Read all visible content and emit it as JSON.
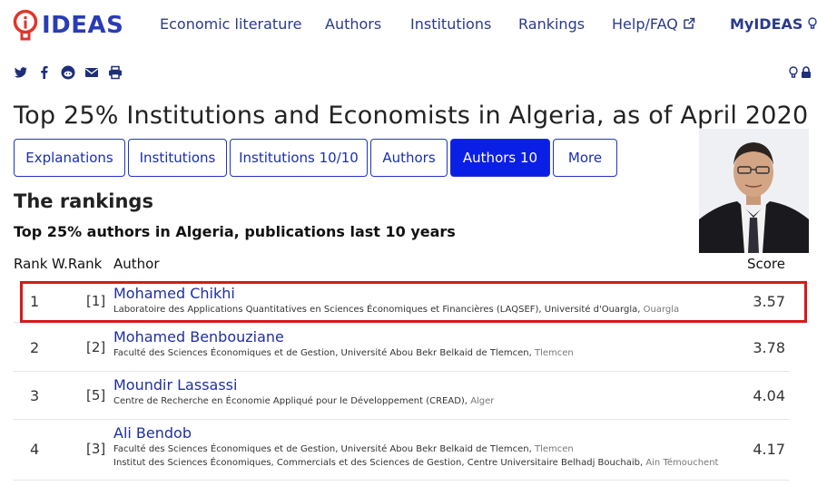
{
  "brand": {
    "logo_text": "IDEAS"
  },
  "nav": {
    "items": [
      {
        "label": "Economic literature"
      },
      {
        "label": "Authors"
      },
      {
        "label": "Institutions"
      },
      {
        "label": "Rankings"
      },
      {
        "label": "Help/FAQ"
      },
      {
        "label": "MyIDEAS"
      }
    ],
    "overflow_label": "(r"
  },
  "page_title": "Top 25% Institutions and Economists in Algeria, as of April 2020",
  "tabs": [
    {
      "label": "Explanations",
      "active": false
    },
    {
      "label": "Institutions",
      "active": false
    },
    {
      "label": "Institutions 10/10",
      "active": false
    },
    {
      "label": "Authors",
      "active": false
    },
    {
      "label": "Authors 10",
      "active": true
    },
    {
      "label": "More",
      "active": false
    }
  ],
  "section_title": "The rankings",
  "table_caption": "Top 25% authors in Algeria, publications last 10 years",
  "table": {
    "headers": {
      "rank": "Rank",
      "wrank": "W.Rank",
      "author": "Author",
      "score": "Score"
    },
    "rows": [
      {
        "rank": "1",
        "wrank": "[1]",
        "name": "Mohamed Chikhi",
        "affiliations": [
          {
            "text": "Laboratoire des Applications Quantitatives en Sciences Économiques et Financières (LAQSEF), Université d'Ouargla,",
            "place": "Ouargla"
          }
        ],
        "score": "3.57"
      },
      {
        "rank": "2",
        "wrank": "[2]",
        "name": "Mohamed Benbouziane",
        "affiliations": [
          {
            "text": "Faculté des Sciences Économiques et de Gestion, Université Abou Bekr Belkaid de Tlemcen,",
            "place": "Tlemcen"
          }
        ],
        "score": "3.78"
      },
      {
        "rank": "3",
        "wrank": "[5]",
        "name": "Moundir Lassassi",
        "affiliations": [
          {
            "text": "Centre de Recherche en Économie Appliqué pour le Développement (CREAD),",
            "place": "Alger"
          }
        ],
        "score": "4.04"
      },
      {
        "rank": "4",
        "wrank": "[3]",
        "name": "Ali Bendob",
        "affiliations": [
          {
            "text": "Faculté des Sciences Économiques et de Gestion, Université Abou Bekr Belkaid de Tlemcen,",
            "place": "Tlemcen"
          },
          {
            "text": "Institut des Sciences Économiques, Commercials et des Sciences de Gestion, Centre Universitaire Belhadj Bouchaib,",
            "place": "Ain Témouchent"
          }
        ],
        "score": "4.17"
      }
    ]
  },
  "colors": {
    "accent": "#0a1fe6",
    "link": "#1f2fa0",
    "highlight": "#d41a1a",
    "logo_mark": "#e0352b"
  },
  "icons": [
    "twitter-icon",
    "facebook-icon",
    "reddit-icon",
    "email-icon",
    "print-icon",
    "bulb-icon",
    "lock-icon",
    "external-link-icon"
  ]
}
